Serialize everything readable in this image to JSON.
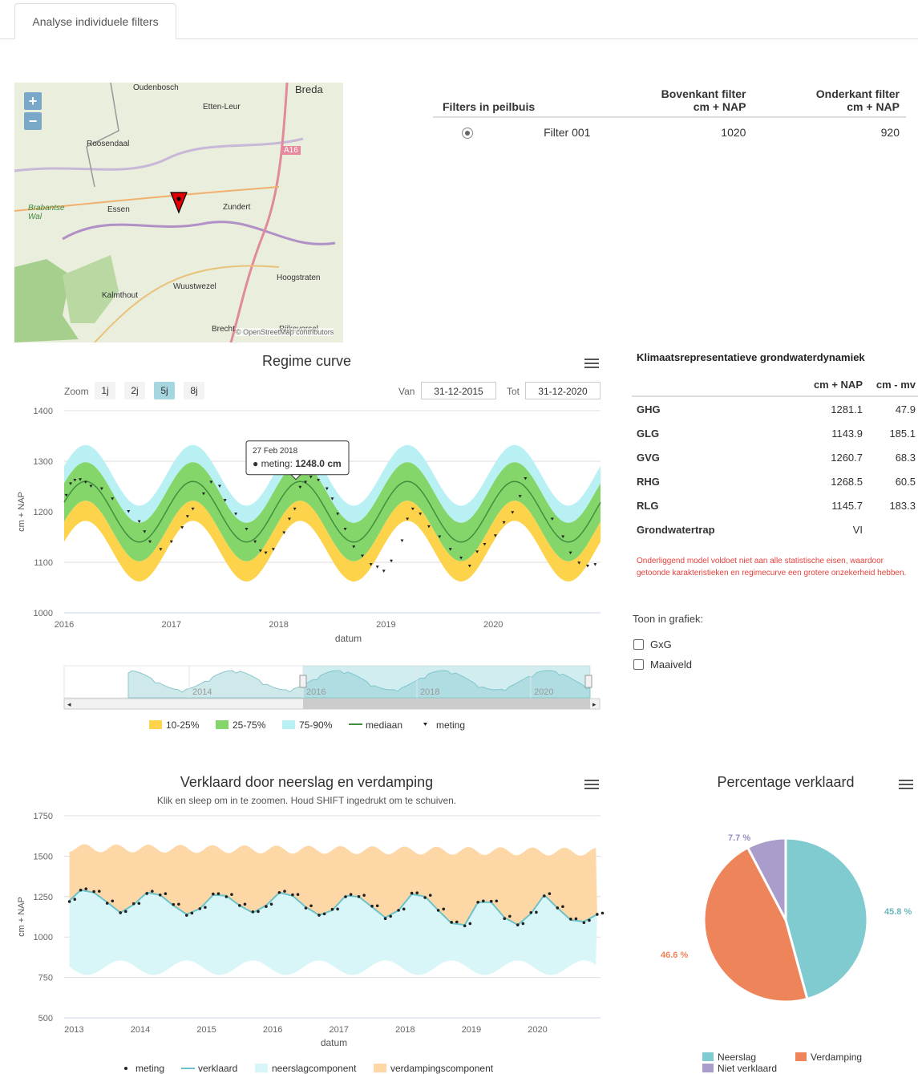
{
  "tab": {
    "label": "Analyse individuele filters"
  },
  "map": {
    "labels": [
      "Breda",
      "Oudenbosch",
      "Etten-Leur",
      "Roosendaal",
      "A16",
      "Brabantse Wal",
      "Essen",
      "Zundert",
      "Hoogstraten",
      "Wuustwezel",
      "Kalmthout",
      "Brecht",
      "Rijkevorsel",
      "© OpenStreetMap contributors"
    ],
    "zoom_in": "+",
    "zoom_out": "−"
  },
  "filters": {
    "headers": {
      "peilbuis": "Filters in peilbuis",
      "boven1": "Bovenkant filter",
      "boven2": "cm + NAP",
      "onder1": "Onderkant filter",
      "onder2": "cm + NAP"
    },
    "rows": [
      {
        "name": "Filter 001",
        "bovenkant": "1020",
        "onderkant": "920"
      }
    ]
  },
  "klimaat": {
    "title": "Klimaatsrepresentatieve grondwaterdynamiek",
    "col1": "cm + NAP",
    "col2": "cm - mv",
    "rows": [
      {
        "label": "GHG",
        "nap": "1281.1",
        "mv": "47.9"
      },
      {
        "label": "GLG",
        "nap": "1143.9",
        "mv": "185.1"
      },
      {
        "label": "GVG",
        "nap": "1260.7",
        "mv": "68.3"
      },
      {
        "label": "RHG",
        "nap": "1268.5",
        "mv": "60.5"
      },
      {
        "label": "RLG",
        "nap": "1145.7",
        "mv": "183.3"
      },
      {
        "label": "Grondwatertrap",
        "nap": "VI",
        "mv": ""
      }
    ],
    "warning": "Onderliggend model voldoet niet aan alle statistische eisen, waardoor getoonde karakteristieken en regimecurve een grotere onzekerheid hebben.",
    "toon": "Toon in grafiek:",
    "options": [
      "GxG",
      "Maaiveld"
    ]
  },
  "regime": {
    "title": "Regime curve",
    "zoom_label": "Zoom",
    "zoom_buttons": [
      "1j",
      "2j",
      "5j",
      "8j"
    ],
    "van_label": "Van",
    "van": "31-12-2015",
    "tot_label": "Tot",
    "tot": "31-12-2020",
    "tooltip_date": "27 Feb 2018",
    "tooltip_series": "meting:",
    "tooltip_value": "1248.0 cm",
    "navigator_labels": [
      "2014",
      "2016",
      "2018",
      "2020"
    ],
    "legend": [
      "10-25%",
      "25-75%",
      "75-90%",
      "mediaan",
      "meting"
    ]
  },
  "verklaard": {
    "title": "Verklaard door neerslag en verdamping",
    "subtitle": "Klik en sleep om in te zoomen. Houd SHIFT ingedrukt om te schuiven.",
    "legend": [
      "meting",
      "verklaard",
      "neerslagcomponent",
      "verdampingscomponent"
    ]
  },
  "pie": {
    "title": "Percentage verklaard",
    "legend": [
      "Neerslag",
      "Verdamping",
      "Niet verklaard"
    ]
  },
  "colors": {
    "p10": "#fcd34a",
    "p25": "#84d66a",
    "p75": "#b8f0f4",
    "mediaan": "#3f8f3f",
    "neerslag": "#d8f6f8",
    "verdamping": "#fed7a6",
    "pie_neerslag": "#80cbcf",
    "pie_verdamping": "#ee8459",
    "pie_niet": "#aa9ccb"
  },
  "chart_data": [
    {
      "type": "area",
      "title": "Regime curve",
      "xlabel": "datum",
      "ylabel": "cm + NAP",
      "ylim": [
        1000,
        1400
      ],
      "yticks": [
        "1000",
        "1100",
        "1200",
        "1300",
        "1400"
      ],
      "xticks": [
        "2016",
        "2017",
        "2018",
        "2019",
        "2020"
      ],
      "xlim": [
        2016.0,
        2021.0
      ],
      "band_series": {
        "mediaan_mean": 1200,
        "mediaan_amp": 60,
        "p25_offset": 38,
        "p75_offset": 38,
        "p10_offset": 78,
        "p90_offset": 72,
        "peak_phase": 0.2
      },
      "series": [
        {
          "name": "meting",
          "points": [
            [
              2016.02,
              1232
            ],
            [
              2016.06,
              1255
            ],
            [
              2016.1,
              1262
            ],
            [
              2016.15,
              1263
            ],
            [
              2016.2,
              1258
            ],
            [
              2016.25,
              1250
            ],
            [
              2016.35,
              1245
            ],
            [
              2016.45,
              1225
            ],
            [
              2016.6,
              1200
            ],
            [
              2016.7,
              1180
            ],
            [
              2016.75,
              1160
            ],
            [
              2016.8,
              1140
            ],
            [
              2016.9,
              1125
            ],
            [
              2017.0,
              1140
            ],
            [
              2017.1,
              1168
            ],
            [
              2017.15,
              1190
            ],
            [
              2017.2,
              1205
            ],
            [
              2017.3,
              1235
            ],
            [
              2017.37,
              1258
            ],
            [
              2017.45,
              1250
            ],
            [
              2017.5,
              1222
            ],
            [
              2017.6,
              1195
            ],
            [
              2017.7,
              1165
            ],
            [
              2017.78,
              1140
            ],
            [
              2017.83,
              1122
            ],
            [
              2017.88,
              1118
            ],
            [
              2017.95,
              1125
            ],
            [
              2018.05,
              1158
            ],
            [
              2018.1,
              1185
            ],
            [
              2018.15,
              1205
            ],
            [
              2018.2,
              1248
            ],
            [
              2018.25,
              1258
            ],
            [
              2018.3,
              1268
            ],
            [
              2018.37,
              1262
            ],
            [
              2018.45,
              1245
            ],
            [
              2018.5,
              1225
            ],
            [
              2018.55,
              1195
            ],
            [
              2018.62,
              1165
            ],
            [
              2018.7,
              1130
            ],
            [
              2018.78,
              1112
            ],
            [
              2018.86,
              1095
            ],
            [
              2018.92,
              1090
            ],
            [
              2018.98,
              1082
            ],
            [
              2019.05,
              1102
            ],
            [
              2019.15,
              1142
            ],
            [
              2019.2,
              1185
            ],
            [
              2019.25,
              1205
            ],
            [
              2019.32,
              1195
            ],
            [
              2019.4,
              1170
            ],
            [
              2019.5,
              1150
            ],
            [
              2019.6,
              1125
            ],
            [
              2019.7,
              1108
            ],
            [
              2019.78,
              1092
            ],
            [
              2019.85,
              1120
            ],
            [
              2019.92,
              1135
            ],
            [
              2020.02,
              1152
            ],
            [
              2020.1,
              1178
            ],
            [
              2020.18,
              1198
            ],
            [
              2020.25,
              1230
            ],
            [
              2020.3,
              1265
            ],
            [
              2020.55,
              1185
            ],
            [
              2020.65,
              1150
            ],
            [
              2020.72,
              1118
            ],
            [
              2020.8,
              1098
            ],
            [
              2020.88,
              1092
            ],
            [
              2020.95,
              1095
            ]
          ]
        }
      ]
    },
    {
      "type": "line",
      "title": "Verklaard door neerslag en verdamping",
      "xlabel": "datum",
      "ylabel": "cm + NAP",
      "ylim": [
        500,
        1750
      ],
      "yticks": [
        "500",
        "750",
        "1000",
        "1250",
        "1500",
        "1750"
      ],
      "xticks": [
        "2013",
        "2014",
        "2015",
        "2016",
        "2017",
        "2018",
        "2019",
        "2020"
      ],
      "xlim": [
        2012.85,
        2020.95
      ],
      "series": [
        {
          "name": "verklaard",
          "points": [
            [
              2012.93,
              1225
            ],
            [
              2013.1,
              1290
            ],
            [
              2013.3,
              1275
            ],
            [
              2013.5,
              1215
            ],
            [
              2013.7,
              1150
            ],
            [
              2013.9,
              1200
            ],
            [
              2014.1,
              1275
            ],
            [
              2014.3,
              1260
            ],
            [
              2014.5,
              1195
            ],
            [
              2014.7,
              1140
            ],
            [
              2014.9,
              1175
            ],
            [
              2015.1,
              1260
            ],
            [
              2015.3,
              1255
            ],
            [
              2015.5,
              1195
            ],
            [
              2015.7,
              1150
            ],
            [
              2015.9,
              1195
            ],
            [
              2016.1,
              1275
            ],
            [
              2016.3,
              1255
            ],
            [
              2016.5,
              1185
            ],
            [
              2016.7,
              1135
            ],
            [
              2016.9,
              1165
            ],
            [
              2017.1,
              1255
            ],
            [
              2017.3,
              1250
            ],
            [
              2017.5,
              1185
            ],
            [
              2017.7,
              1120
            ],
            [
              2017.9,
              1165
            ],
            [
              2018.1,
              1265
            ],
            [
              2018.3,
              1250
            ],
            [
              2018.5,
              1165
            ],
            [
              2018.7,
              1085
            ],
            [
              2018.9,
              1075
            ],
            [
              2019.1,
              1215
            ],
            [
              2019.3,
              1215
            ],
            [
              2019.5,
              1120
            ],
            [
              2019.7,
              1075
            ],
            [
              2019.9,
              1145
            ],
            [
              2020.1,
              1260
            ],
            [
              2020.3,
              1180
            ],
            [
              2020.5,
              1105
            ],
            [
              2020.7,
              1095
            ],
            [
              2020.9,
              1140
            ]
          ]
        },
        {
          "name": "neerslagcomponent",
          "baseline": 850
        },
        {
          "name": "verdampingscomponent",
          "top": 1550
        }
      ]
    },
    {
      "type": "pie",
      "title": "Percentage verklaard",
      "slices": [
        {
          "name": "Neerslag",
          "value": 45.8,
          "label": "45.8 %"
        },
        {
          "name": "Verdamping",
          "value": 46.6,
          "label": "46.6 %"
        },
        {
          "name": "Niet verklaard",
          "value": 7.7,
          "label": "7.7 %"
        }
      ]
    }
  ]
}
